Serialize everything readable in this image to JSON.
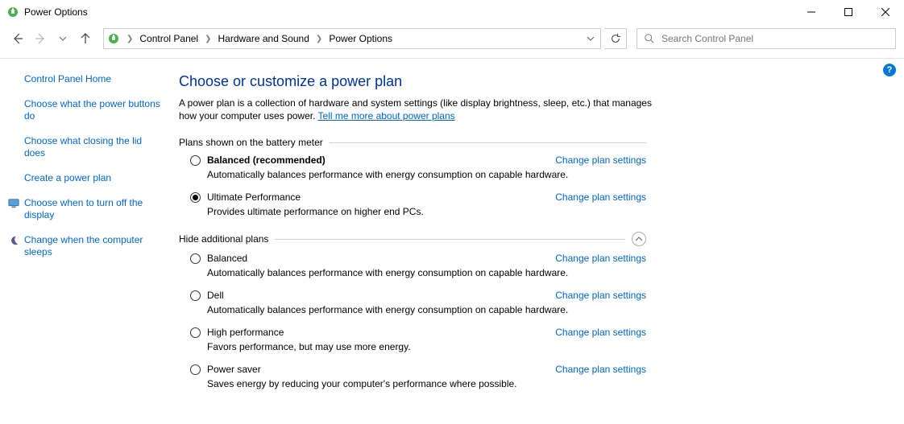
{
  "window": {
    "title": "Power Options"
  },
  "breadcrumbs": {
    "b0": "Control Panel",
    "b1": "Hardware and Sound",
    "b2": "Power Options"
  },
  "search": {
    "placeholder": "Search Control Panel"
  },
  "sidebar": {
    "home": "Control Panel Home",
    "l0": "Choose what the power buttons do",
    "l1": "Choose what closing the lid does",
    "l2": "Create a power plan",
    "l3": "Choose when to turn off the display",
    "l4": "Change when the computer sleeps"
  },
  "page": {
    "title": "Choose or customize a power plan",
    "desc1": "A power plan is a collection of hardware and system settings (like display brightness, sleep, etc.) that manages how your computer uses power. ",
    "learn_more": "Tell me more about power plans",
    "section1": "Plans shown on the battery meter",
    "section2": "Hide additional plans",
    "change": "Change plan settings"
  },
  "plans_meter": [
    {
      "name": "Balanced (recommended)",
      "desc": "Automatically balances performance with energy consumption on capable hardware.",
      "bold": true,
      "selected": false
    },
    {
      "name": "Ultimate Performance",
      "desc": "Provides ultimate performance on higher end PCs.",
      "bold": false,
      "selected": true
    }
  ],
  "plans_additional": [
    {
      "name": "Balanced",
      "desc": "Automatically balances performance with energy consumption on capable hardware."
    },
    {
      "name": "Dell",
      "desc": "Automatically balances performance with energy consumption on capable hardware."
    },
    {
      "name": "High performance",
      "desc": "Favors performance, but may use more energy."
    },
    {
      "name": "Power saver",
      "desc": "Saves energy by reducing your computer's performance where possible."
    }
  ]
}
